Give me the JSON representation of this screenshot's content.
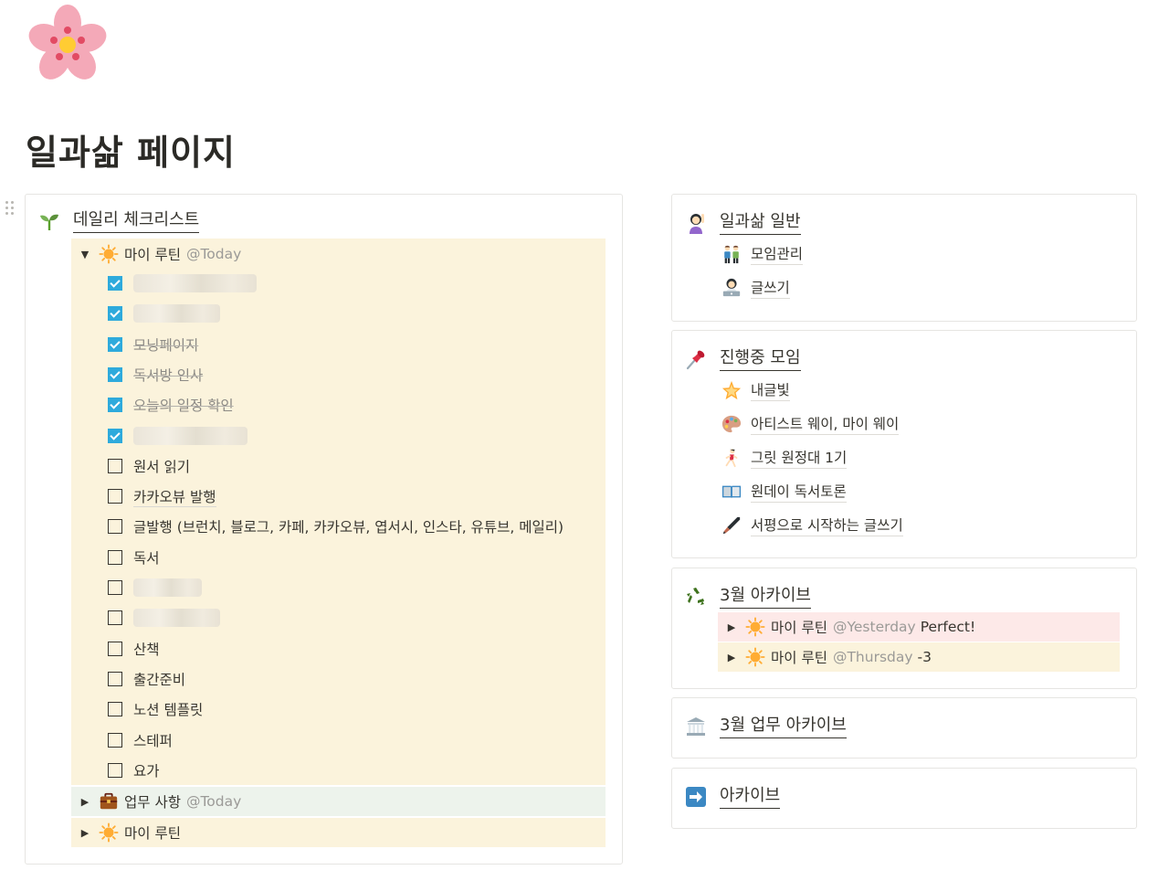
{
  "page": {
    "title": "일과삶 페이지",
    "icon": "cherry-blossom-icon"
  },
  "left_card": {
    "title": "데일리 체크리스트",
    "icon": "seedling-icon",
    "routine_toggle": {
      "label": "마이 루틴",
      "mention": "@Today",
      "icon": "sun-icon",
      "bg": "#fbf3dc"
    },
    "checklist": [
      {
        "label": "",
        "checked": true,
        "hidden": true
      },
      {
        "label": "",
        "checked": true,
        "hidden": true
      },
      {
        "label": "모닝페이지",
        "checked": true
      },
      {
        "label": "독서방 인사",
        "checked": true
      },
      {
        "label": "오늘의 일정 확인",
        "checked": true
      },
      {
        "label": "",
        "checked": true,
        "hidden": true
      },
      {
        "label": "원서 읽기",
        "checked": false
      },
      {
        "label": "카카오뷰 발행",
        "checked": false
      },
      {
        "label": "글발행 (브런치, 블로그, 카페, 카카오뷰, 엽서시, 인스타, 유튜브, 메일리)",
        "checked": false
      },
      {
        "label": "독서",
        "checked": false
      },
      {
        "label": "",
        "checked": false,
        "hidden": true
      },
      {
        "label": "",
        "checked": false,
        "hidden": true
      },
      {
        "label": "산책",
        "checked": false
      },
      {
        "label": "출간준비",
        "checked": false
      },
      {
        "label": "노션 템플릿",
        "checked": false
      },
      {
        "label": "스테퍼",
        "checked": false
      },
      {
        "label": "요가",
        "checked": false
      }
    ],
    "work_toggle": {
      "label": "업무 사항",
      "mention": "@Today",
      "icon": "briefcase-icon",
      "bg": "#edf3ec"
    },
    "routine_toggle_2": {
      "label": "마이 루틴",
      "icon": "sun-icon",
      "bg": "#fbf3dc"
    }
  },
  "cards": {
    "life": {
      "title": "일과삶 일반",
      "icon": "woman-raising-hand-icon",
      "links": [
        {
          "label": "모임관리",
          "icon": "people-holding-hands-icon"
        },
        {
          "label": "글쓰기",
          "icon": "woman-technologist-icon"
        }
      ]
    },
    "meetings": {
      "title": "진행중 모임",
      "icon": "pushpin-icon",
      "links": [
        {
          "label": "내글빛",
          "icon": "glowing-star-icon"
        },
        {
          "label": "아티스트 웨이, 마이 웨이",
          "icon": "palette-icon"
        },
        {
          "label": "그릿 원정대 1기",
          "icon": "woman-running-icon"
        },
        {
          "label": "원데이 독서토론",
          "icon": "open-book-icon"
        },
        {
          "label": "서평으로 시작하는 글쓰기",
          "icon": "fountain-pen-icon"
        }
      ]
    },
    "march_archive": {
      "title": "3월 아카이브",
      "icon": "recycle-icon",
      "rows": [
        {
          "label": "마이 루틴",
          "mention": "@Yesterday",
          "extra": "Perfect!",
          "bg": "#fde9e8"
        },
        {
          "label": "마이 루틴",
          "mention": "@Thursday",
          "extra": "-3",
          "bg": "#fbf3dc"
        }
      ]
    },
    "work_archive": {
      "title": "3월 업무 아카이브",
      "icon": "classical-building-icon"
    },
    "archive": {
      "title": "아카이브",
      "icon": "right-arrow-icon"
    }
  },
  "colors": {
    "checkbox_blue": "#2eaadc",
    "text": "#37352f",
    "muted": "#9b9a97"
  }
}
